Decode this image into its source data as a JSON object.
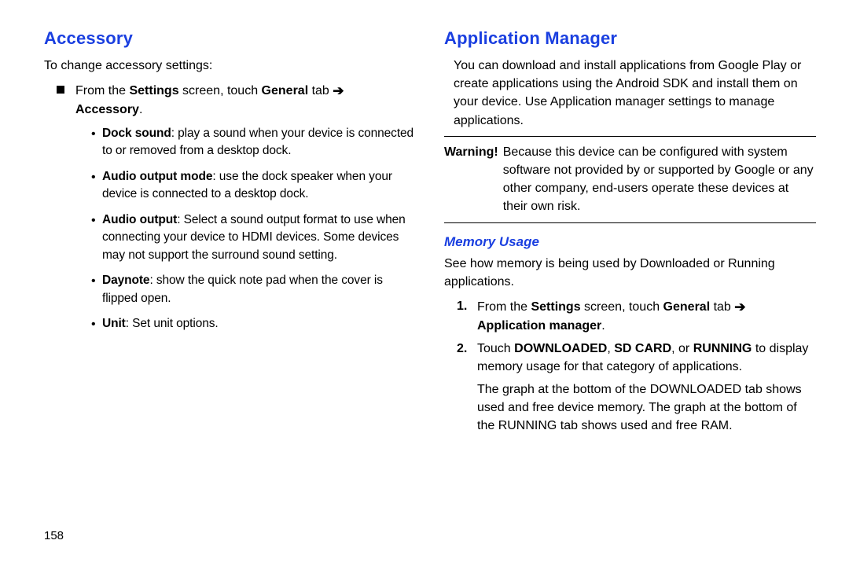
{
  "page_number": "158",
  "left": {
    "heading": "Accessory",
    "intro": "To change accessory settings:",
    "square_prefix": "From the ",
    "square_b1": "Settings",
    "square_mid1": " screen, touch ",
    "square_b2": "General",
    "square_mid2": " tab ",
    "arrow": "➔",
    "square_b3": "Accessory",
    "square_suffix": ".",
    "bullets": [
      {
        "bold": "Dock sound",
        "rest": ": play a sound when your device is connected to or removed from a desktop dock."
      },
      {
        "bold": "Audio output mode",
        "rest": ": use the dock speaker when your device is connected to a desktop dock."
      },
      {
        "bold": "Audio output",
        "rest": ": Select a sound output format to use when connecting your device to HDMI devices. Some devices may not support the surround sound setting."
      },
      {
        "bold": "Daynote",
        "rest": ": show the quick note pad when the cover is flipped open."
      },
      {
        "bold": "Unit",
        "rest": ": Set unit options."
      }
    ]
  },
  "right": {
    "heading": "Application Manager",
    "intro": "You can download and install applications from Google Play or create applications using the Android SDK and install them on your device. Use Application manager settings to manage applications.",
    "warning_label": "Warning!",
    "warning_text": "Because this device can be configured with system software not provided by or supported by Google or any other company, end-users operate these devices at their own risk.",
    "sub_heading": "Memory Usage",
    "sub_intro": "See how memory is being used by Downloaded or Running applications.",
    "step1_n": "1.",
    "step1_pre": "From the ",
    "step1_b1": "Settings",
    "step1_mid1": " screen, touch ",
    "step1_b2": "General",
    "step1_mid2": " tab ",
    "step1_arrow": "➔",
    "step1_b3": "Application manager",
    "step1_suf": ".",
    "step2_n": "2.",
    "step2_pre": "Touch ",
    "step2_b1": "DOWNLOADED",
    "step2_sep1": ", ",
    "step2_b2": "SD CARD",
    "step2_sep2": ", or ",
    "step2_b3": "RUNNING",
    "step2_suf": " to display memory usage for that category of applications.",
    "step2_cont": "The graph at the bottom of the DOWNLOADED tab shows used and free device memory. The graph at the bottom of the RUNNING tab shows used and free RAM."
  }
}
